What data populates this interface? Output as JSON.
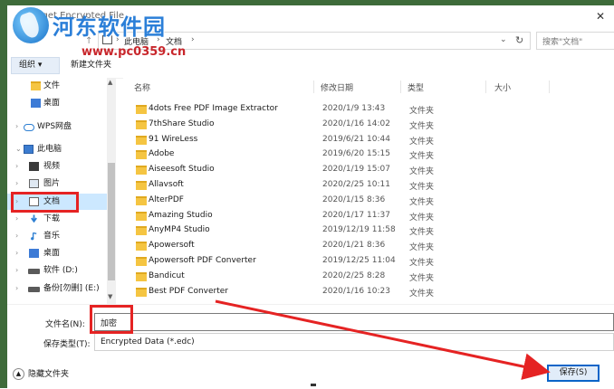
{
  "window": {
    "title": "Target Encrypted File",
    "close_glyph": "✕"
  },
  "watermark": {
    "site_name": "河东软件园",
    "url": "www.pc0359.cn"
  },
  "address_bar": {
    "up_glyph": "↑",
    "separator_glyph": "›",
    "breadcrumb": [
      "此电脑",
      "文档"
    ],
    "dropdown_glyph": "⌄",
    "refresh_glyph": "↻",
    "search_placeholder": "搜索\"文档\""
  },
  "toolbar": {
    "organize_label": "组织 ▾",
    "new_folder_label": "新建文件夹"
  },
  "nav_pane": {
    "scroll_up_glyph": "▲",
    "scroll_down_glyph": "▼",
    "items": [
      {
        "label": "文件",
        "icon": "folder-icon",
        "chevron": ""
      },
      {
        "label": "桌面",
        "icon": "desktop-folder-icon",
        "chevron": ""
      },
      {
        "label": "WPS网盘",
        "icon": "cloud-icon",
        "chevron": "›"
      },
      {
        "label": "此电脑",
        "icon": "computer-icon",
        "chevron": "⌄"
      },
      {
        "label": "视频",
        "icon": "video-icon",
        "chevron": "›"
      },
      {
        "label": "图片",
        "icon": "pictures-icon",
        "chevron": "›"
      },
      {
        "label": "文档",
        "icon": "document-icon",
        "chevron": "›"
      },
      {
        "label": "下载",
        "icon": "download-icon",
        "chevron": "›"
      },
      {
        "label": "音乐",
        "icon": "music-icon",
        "chevron": "›"
      },
      {
        "label": "桌面",
        "icon": "desktop-icon",
        "chevron": "›"
      },
      {
        "label": "软件 (D:)",
        "icon": "drive-icon",
        "chevron": "›"
      },
      {
        "label": "备份[勿删] (E:)",
        "icon": "drive-icon",
        "chevron": "›"
      }
    ]
  },
  "file_list": {
    "columns": [
      "名称",
      "修改日期",
      "类型",
      "大小"
    ],
    "rows": [
      {
        "name": "4dots Free PDF Image Extractor",
        "date": "2020/1/9 13:43",
        "type": "文件夹"
      },
      {
        "name": "7thShare Studio",
        "date": "2020/1/16 14:02",
        "type": "文件夹"
      },
      {
        "name": "91 WireLess",
        "date": "2019/6/21 10:44",
        "type": "文件夹"
      },
      {
        "name": "Adobe",
        "date": "2019/6/20 15:15",
        "type": "文件夹"
      },
      {
        "name": "Aiseesoft Studio",
        "date": "2020/1/19 15:07",
        "type": "文件夹"
      },
      {
        "name": "Allavsoft",
        "date": "2020/2/25 10:11",
        "type": "文件夹"
      },
      {
        "name": "AlterPDF",
        "date": "2020/1/15 8:36",
        "type": "文件夹"
      },
      {
        "name": "Amazing Studio",
        "date": "2020/1/17 11:37",
        "type": "文件夹"
      },
      {
        "name": "AnyMP4 Studio",
        "date": "2019/12/19 11:58",
        "type": "文件夹"
      },
      {
        "name": "Apowersoft",
        "date": "2020/1/21 8:36",
        "type": "文件夹"
      },
      {
        "name": "Apowersoft PDF Converter",
        "date": "2019/12/25 11:04",
        "type": "文件夹"
      },
      {
        "name": "Bandicut",
        "date": "2020/2/25 8:28",
        "type": "文件夹"
      },
      {
        "name": "Best PDF Converter",
        "date": "2020/1/16 10:23",
        "type": "文件夹"
      }
    ]
  },
  "form": {
    "filename_label": "文件名(N):",
    "filename_value": "加密",
    "filetype_label": "保存类型(T):",
    "filetype_value": "Encrypted Data (*.edc)"
  },
  "footer": {
    "hide_folders_glyph": "▲",
    "hide_folders_label": "隐藏文件夹",
    "save_label": "保存(S)"
  },
  "colors": {
    "annotation_red": "#e52323",
    "selection_blue": "#cce8ff",
    "folder_yellow": "#f5c542"
  }
}
